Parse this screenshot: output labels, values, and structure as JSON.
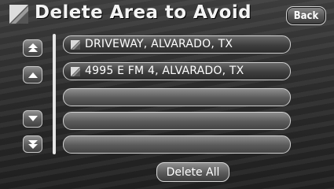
{
  "header": {
    "title": "Delete Area to Avoid",
    "back_label": "Back",
    "title_icon": "area-avoid-icon"
  },
  "scroll": {
    "buttons": [
      {
        "icon": "page-up-icon"
      },
      {
        "icon": "line-up-icon"
      },
      {
        "icon": "line-down-icon"
      },
      {
        "icon": "page-down-icon"
      }
    ]
  },
  "list": {
    "items": [
      {
        "label": "DRIVEWAY, ALVARADO, TX",
        "icon": "area-avoid-icon"
      },
      {
        "label": "4995 E FM 4, ALVARADO, TX",
        "icon": "area-avoid-icon"
      },
      {
        "label": ""
      },
      {
        "label": ""
      },
      {
        "label": ""
      }
    ]
  },
  "footer": {
    "delete_all_label": "Delete All"
  },
  "colors": {
    "text": "#ffffff",
    "button_border": "#d0d0d0",
    "background": "#2a2a2a"
  }
}
